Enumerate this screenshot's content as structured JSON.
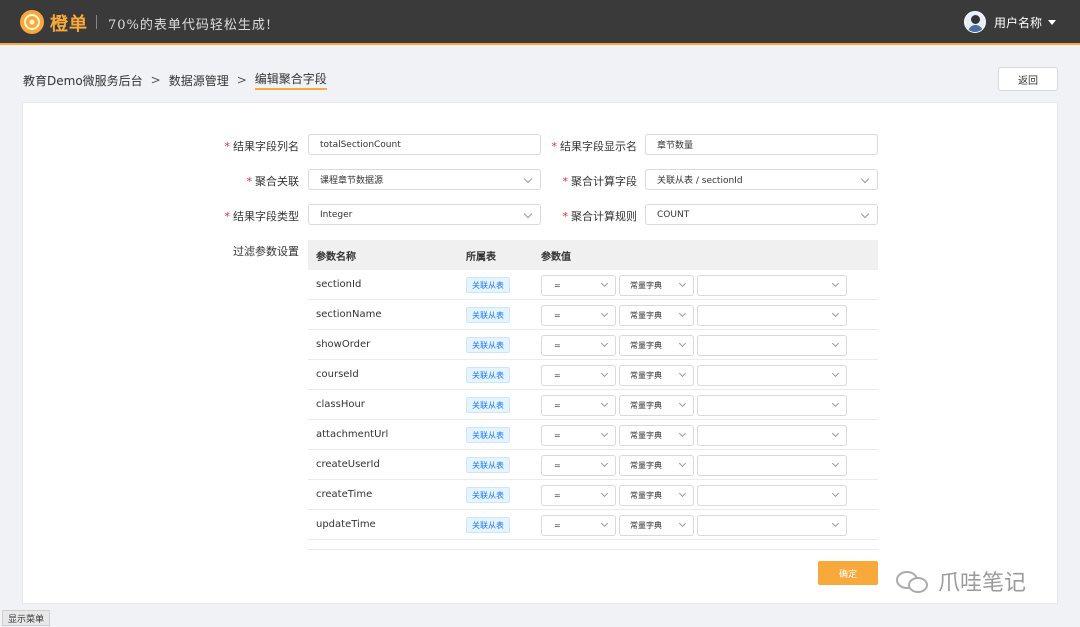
{
  "header": {
    "brand": "橙单",
    "slogan": "70%的表单代码轻松生成!",
    "user_name": "用户名称"
  },
  "breadcrumb": [
    "教育Demo微服务后台",
    "数据源管理",
    "编辑聚合字段"
  ],
  "back_label": "返回",
  "form": {
    "result_field_name": {
      "label": "结果字段列名",
      "value": "totalSectionCount"
    },
    "result_display_name": {
      "label": "结果字段显示名",
      "value": "章节数量"
    },
    "aggregate_relation": {
      "label": "聚合关联",
      "value": "课程章节数据源"
    },
    "aggregate_field": {
      "label": "聚合计算字段",
      "value": "关联从表 / sectionId"
    },
    "result_field_type": {
      "label": "结果字段类型",
      "value": "Integer"
    },
    "aggregate_rule": {
      "label": "聚合计算规则",
      "value": "COUNT"
    },
    "filter_label": "过滤参数设置"
  },
  "table": {
    "headers": [
      "参数名称",
      "所属表",
      "参数值"
    ],
    "rows": [
      {
        "name": "sectionId",
        "table": "关联从表",
        "op": "=",
        "type": "常量字典",
        "value": ""
      },
      {
        "name": "sectionName",
        "table": "关联从表",
        "op": "=",
        "type": "常量字典",
        "value": ""
      },
      {
        "name": "showOrder",
        "table": "关联从表",
        "op": "=",
        "type": "常量字典",
        "value": ""
      },
      {
        "name": "courseId",
        "table": "关联从表",
        "op": "=",
        "type": "常量字典",
        "value": ""
      },
      {
        "name": "classHour",
        "table": "关联从表",
        "op": "=",
        "type": "常量字典",
        "value": ""
      },
      {
        "name": "attachmentUrl",
        "table": "关联从表",
        "op": "=",
        "type": "常量字典",
        "value": ""
      },
      {
        "name": "createUserId",
        "table": "关联从表",
        "op": "=",
        "type": "常量字典",
        "value": ""
      },
      {
        "name": "createTime",
        "table": "关联从表",
        "op": "=",
        "type": "常量字典",
        "value": ""
      },
      {
        "name": "updateTime",
        "table": "关联从表",
        "op": "=",
        "type": "常量字典",
        "value": ""
      }
    ]
  },
  "confirm_label": "确定",
  "watermark": "爪哇笔记",
  "show_menu_label": "显示菜单",
  "colors": {
    "accent": "#f7a93b",
    "topbar": "#3a3a3a",
    "tag_blue": "#1677ff"
  }
}
